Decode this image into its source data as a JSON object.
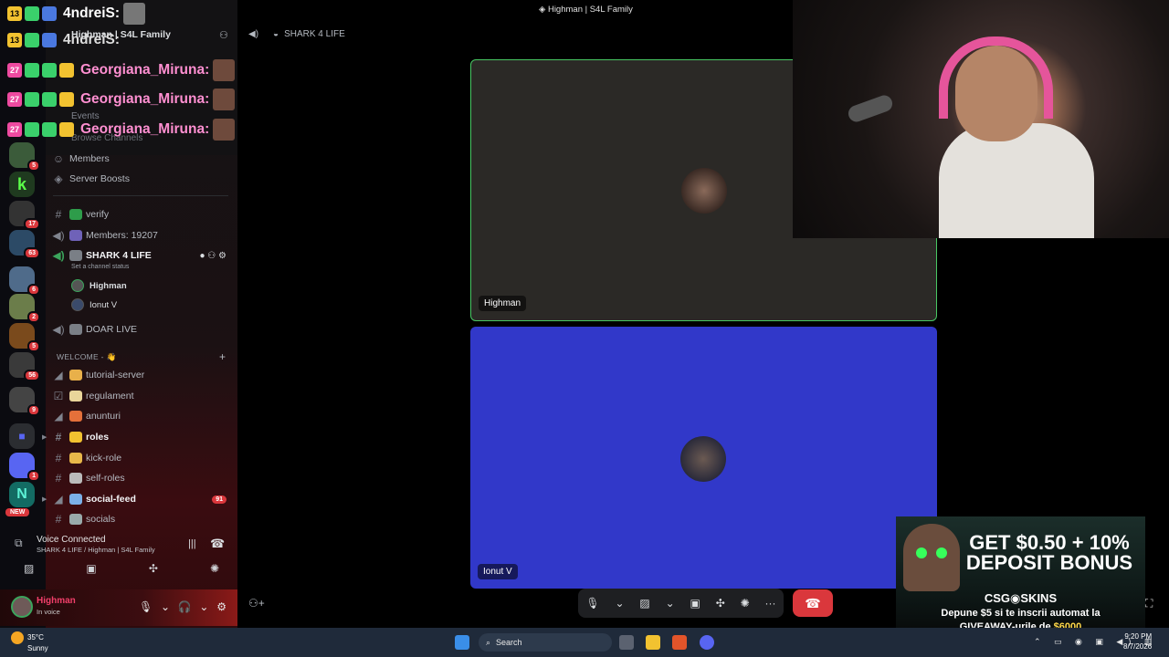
{
  "window": {
    "title": "Highman | S4L Family"
  },
  "chat_overlay": {
    "lines": [
      {
        "badge": "13",
        "name": "4ndreiS:",
        "color": "#ffffff"
      },
      {
        "badge": "13",
        "name": "4ndreiS:",
        "color": "#ffffff"
      },
      {
        "badge": "27",
        "name": "Georgiana_Miruna:",
        "color": "#ff8fd1"
      },
      {
        "badge": "27",
        "name": "Georgiana_Miruna:",
        "color": "#ff8fd1"
      },
      {
        "badge": "27",
        "name": "Georgiana_Miruna:",
        "color": "#ff8fd1"
      }
    ]
  },
  "sidebar": {
    "server_name": "Highman | S4L Family",
    "hidden_items": [
      "Events",
      "Browse Channels"
    ],
    "members": "Members",
    "server_boosts": "Server Boosts",
    "channels": [
      {
        "icon": "#",
        "label": "verify"
      },
      {
        "icon": "speaker",
        "label": "Members: 19207"
      },
      {
        "icon": "speaker",
        "label": "SHARK 4 LIFE",
        "status": "Set a channel status"
      },
      {
        "icon": "speaker",
        "label": "DOAR LIVE"
      }
    ],
    "voice_users": [
      "Highman",
      "Ionut V"
    ],
    "category": "WELCOME - 👋",
    "welcome_channels": [
      {
        "icon": "megaphone",
        "label": "tutorial-server"
      },
      {
        "icon": "rules",
        "label": "regulament"
      },
      {
        "icon": "megaphone",
        "label": "anunturi"
      },
      {
        "icon": "#",
        "label": "roles",
        "bold": true
      },
      {
        "icon": "#",
        "label": "kick-role"
      },
      {
        "icon": "#",
        "label": "self-roles"
      },
      {
        "icon": "megaphone",
        "label": "social-feed",
        "bold": true,
        "count": "91"
      },
      {
        "icon": "#",
        "label": "socials"
      }
    ],
    "rail_badges": [
      "5",
      "17",
      "63",
      "6",
      "2",
      "5",
      "56",
      "9",
      "1"
    ],
    "rail_new": "NEW"
  },
  "voice": {
    "status": "Voice Connected",
    "path": "SHARK 4 LIFE / Highman | S4L Family"
  },
  "user": {
    "name": "Highman",
    "status": "In voice"
  },
  "call": {
    "channel": "SHARK 4 LIFE",
    "tiles": [
      {
        "name": "Highman",
        "bg": "#2b2926"
      },
      {
        "name": "Ionut V",
        "bg": "#3138c9"
      }
    ]
  },
  "ad": {
    "headline": "GET $0.50 + 10% DEPOSIT BONUS",
    "brand": "CSG◉SKINS",
    "line1": "Depune $5 si te inscrii automat la",
    "line2_a": "GIVEAWAY-urile de ",
    "line2_b": "$6000"
  },
  "taskbar": {
    "weather_temp": "35°C",
    "weather_desc": "Sunny",
    "search": "Search",
    "time": "9:20 PM",
    "date": "8/7/2026"
  }
}
